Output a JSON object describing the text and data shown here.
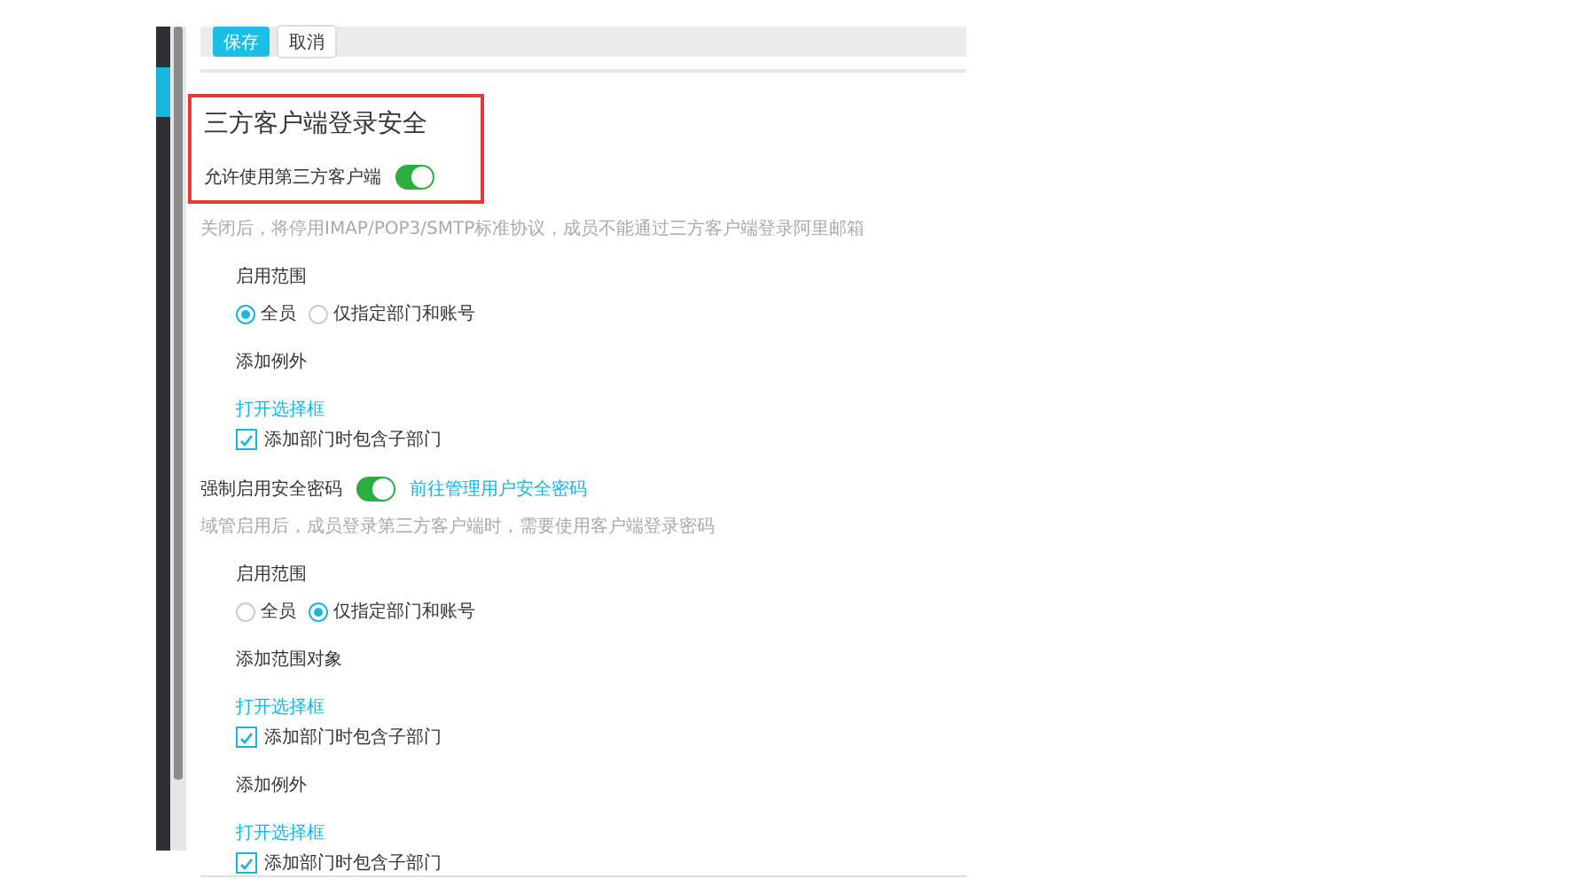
{
  "toolbar": {
    "buttons": [
      {
        "label": "保存",
        "kind": "primary"
      },
      {
        "label": "取消",
        "kind": "default"
      }
    ]
  },
  "section": {
    "title": "三方客户端登录安全",
    "highlighted": true
  },
  "settings": [
    {
      "label": "允许使用第三方客户端",
      "on": true,
      "hint": "关闭后，将停用IMAP/POP3/SMTP标准协议，成员不能通过三方客户端登录阿里邮箱",
      "blocks": [
        {
          "kind": "heading",
          "text": "启用范围"
        },
        {
          "kind": "radios",
          "options": [
            {
              "label": "全员",
              "selected": true
            },
            {
              "label": "仅指定部门和账号",
              "selected": false
            }
          ]
        },
        {
          "kind": "heading",
          "text": "添加例外"
        },
        {
          "kind": "link",
          "text": "打开选择框"
        },
        {
          "kind": "checkbox",
          "label": "添加部门时包含子部门",
          "checked": true
        }
      ]
    },
    {
      "label": "强制启用安全密码",
      "on": true,
      "link": "前往管理用户安全密码",
      "hint": "域管启用后，成员登录第三方客户端时，需要使用客户端登录密码",
      "blocks": [
        {
          "kind": "heading",
          "text": "启用范围"
        },
        {
          "kind": "radios",
          "options": [
            {
              "label": "全员",
              "selected": false
            },
            {
              "label": "仅指定部门和账号",
              "selected": true
            }
          ]
        },
        {
          "kind": "heading",
          "text": "添加范围对象"
        },
        {
          "kind": "link",
          "text": "打开选择框"
        },
        {
          "kind": "checkbox",
          "label": "添加部门时包含子部门",
          "checked": true
        },
        {
          "kind": "heading",
          "text": "添加例外"
        },
        {
          "kind": "link",
          "text": "打开选择框"
        },
        {
          "kind": "checkbox",
          "label": "添加部门时包含子部门",
          "checked": true
        }
      ]
    }
  ]
}
